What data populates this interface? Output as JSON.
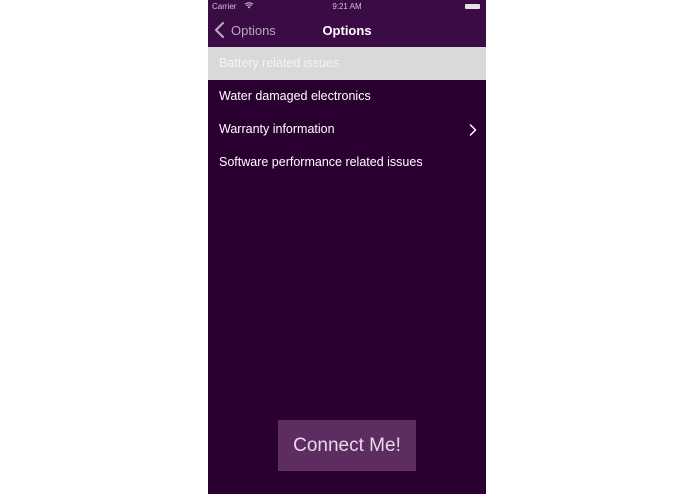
{
  "status_bar": {
    "carrier": "Carrier",
    "wifi_icon": "wifi-icon",
    "time": "9:21 AM",
    "battery_icon": "battery-icon"
  },
  "nav": {
    "back_label": "Options",
    "title": "Options"
  },
  "list": {
    "items": [
      {
        "label": "Battery related issues",
        "selected": true,
        "disclosure": false
      },
      {
        "label": "Water damaged electronics",
        "selected": false,
        "disclosure": false
      },
      {
        "label": "Warranty information",
        "selected": false,
        "disclosure": true
      },
      {
        "label": "Software performance related issues",
        "selected": false,
        "disclosure": false
      }
    ]
  },
  "connect_button": {
    "label": "Connect Me!"
  },
  "colors": {
    "background": "#2a0030",
    "navbar": "#3b0b46",
    "selected_row": "#d9d9d9",
    "button": "#5d2d61"
  }
}
